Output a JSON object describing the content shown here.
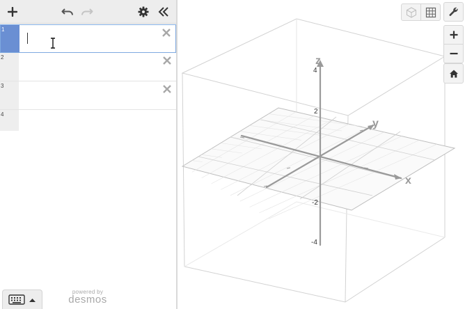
{
  "expressions": [
    {
      "number": "1",
      "value": "",
      "active": true
    },
    {
      "number": "2",
      "value": ""
    },
    {
      "number": "3",
      "value": ""
    },
    {
      "number": "4",
      "value": ""
    }
  ],
  "branding": {
    "powered_by": "powered by",
    "name": "desmos"
  },
  "graph": {
    "axis_labels": {
      "x": "x",
      "y": "y",
      "z": "z"
    },
    "z_ticks": [
      "4",
      "2",
      "-2",
      "-4"
    ]
  },
  "colors": {
    "accent": "#6a8fd3",
    "axis": "#9a9a9a",
    "toolbar": "#ededed"
  },
  "icons": {
    "toolbar": [
      "plus-icon",
      "undo-icon",
      "redo-icon",
      "gear-icon",
      "collapse-icon"
    ],
    "graph_controls": [
      "3d-cube-icon",
      "grid-icon",
      "wrench-icon",
      "zoom-in-icon",
      "zoom-out-icon",
      "home-icon"
    ]
  }
}
